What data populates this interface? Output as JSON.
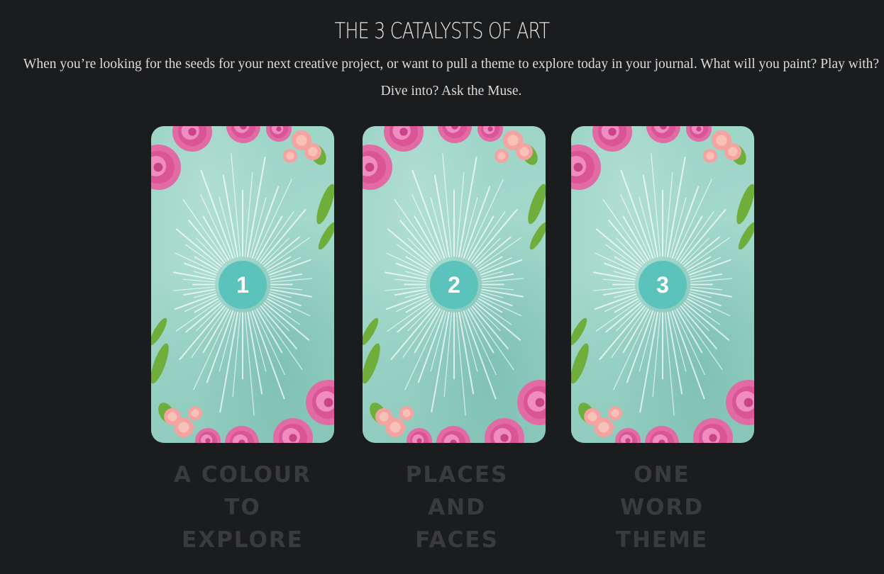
{
  "heading": "THE 3 CATALYSTS OF ART",
  "intro": "When you’re looking for the seeds for your next creative project, or want to pull a theme to explore today in your journal. What will you paint? Play with? Dive into? Ask the Muse.",
  "colors": {
    "background": "#1b1c1e",
    "card_base": "#9bd4c6",
    "badge": "#5cc3bc",
    "label_text": "#3a3b3d",
    "rose": "#e26aa5",
    "leaf": "#6fae3a"
  },
  "cards": [
    {
      "number": "1",
      "label_lines": [
        "A COLOUR",
        "TO",
        "EXPLORE"
      ]
    },
    {
      "number": "2",
      "label_lines": [
        "PLACES",
        "AND",
        "FACES"
      ]
    },
    {
      "number": "3",
      "label_lines": [
        "ONE",
        "WORD",
        "THEME"
      ]
    }
  ]
}
